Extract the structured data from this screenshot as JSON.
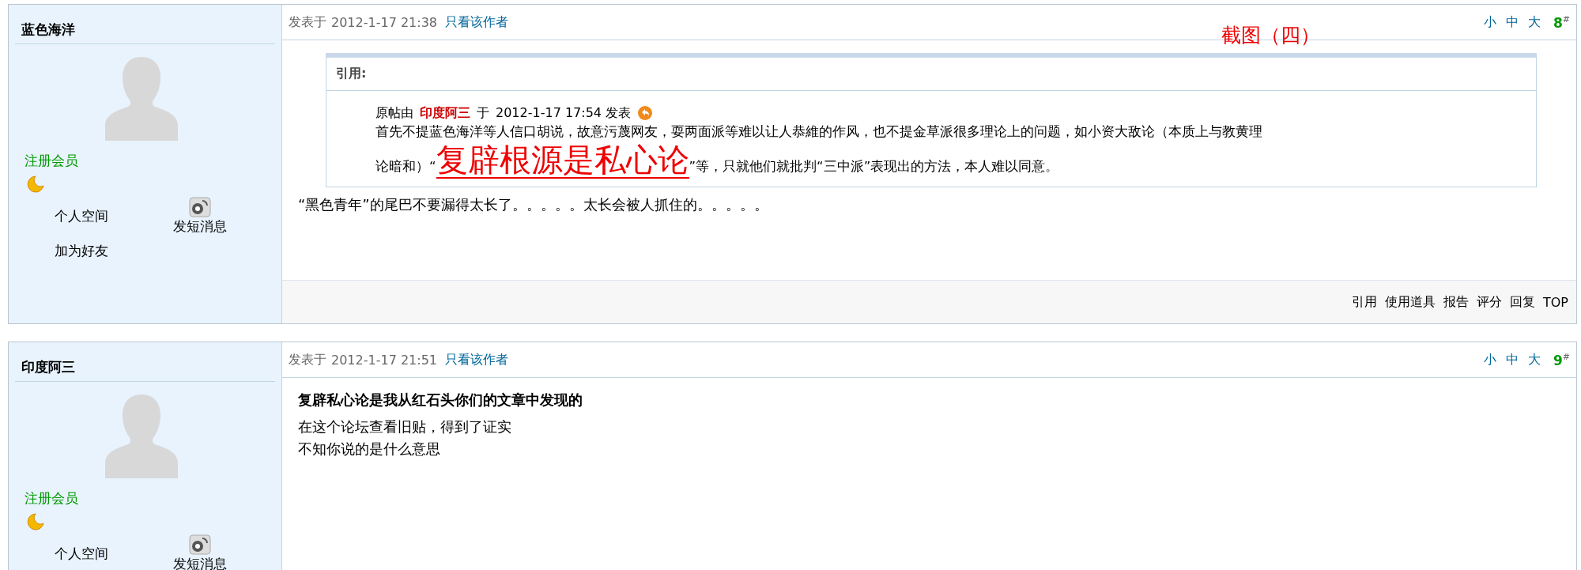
{
  "posts": [
    {
      "author": "蓝色海洋",
      "group": "注册会员",
      "profile_links": [
        {
          "label": "个人空间",
          "kind": "text"
        },
        {
          "label": "发短消息",
          "kind": "icon"
        },
        {
          "label": "加为好友",
          "kind": "text"
        }
      ],
      "posted": "发表于",
      "time": "2012-1-17 21:38",
      "author_only": "只看该作者",
      "font_sizes": [
        "小",
        "中",
        "大"
      ],
      "floor": "8$^{#}$",
      "annotation": "截图（四）",
      "quote": {
        "title": "引用:",
        "byline": {
          "prefix": "原帖由",
          "author": "印度阿三",
          "mid": "于",
          "time": "2012-1-17 17:54 发表"
        },
        "lines": [
          "首先不提蓝色海洋等人信口胡说，故意污蔑网友，耍两面派等难以让人恭維的作风，也不提金草派很多理论上的问题，如小资大敌论（本质上与教黄理"
        ],
        "last_line": {
          "before": "论暗和）“",
          "highlight": "复辟根源是私心论",
          "after": "”等，只就他们就批判“三中派”表现出的方法，本人难以同意。"
        }
      },
      "body": {
        "paragraphs": [
          "“黑色青年”的尾巴不要漏得太长了。。。。。太长会被人抓住的。。。。。"
        ]
      },
      "actions": [
        "引用",
        "使用道具",
        "报告",
        "评分",
        "回复",
        "TOP"
      ]
    },
    {
      "author": "印度阿三",
      "group": "注册会员",
      "profile_links": [
        {
          "label": "个人空间",
          "kind": "text"
        },
        {
          "label": "发短消息",
          "kind": "icon"
        }
      ],
      "posted": "发表于",
      "time": "2012-1-17 21:51",
      "author_only": "只看该作者",
      "font_sizes": [
        "小",
        "中",
        "大"
      ],
      "floor": "9$^{#}$",
      "body": {
        "title": "复辟私心论是我从红石头你们的文章中发现的",
        "paragraphs": [
          "在这个论坛查看旧贴，得到了证实",
          "不知你说的是什么意思"
        ]
      }
    }
  ]
}
